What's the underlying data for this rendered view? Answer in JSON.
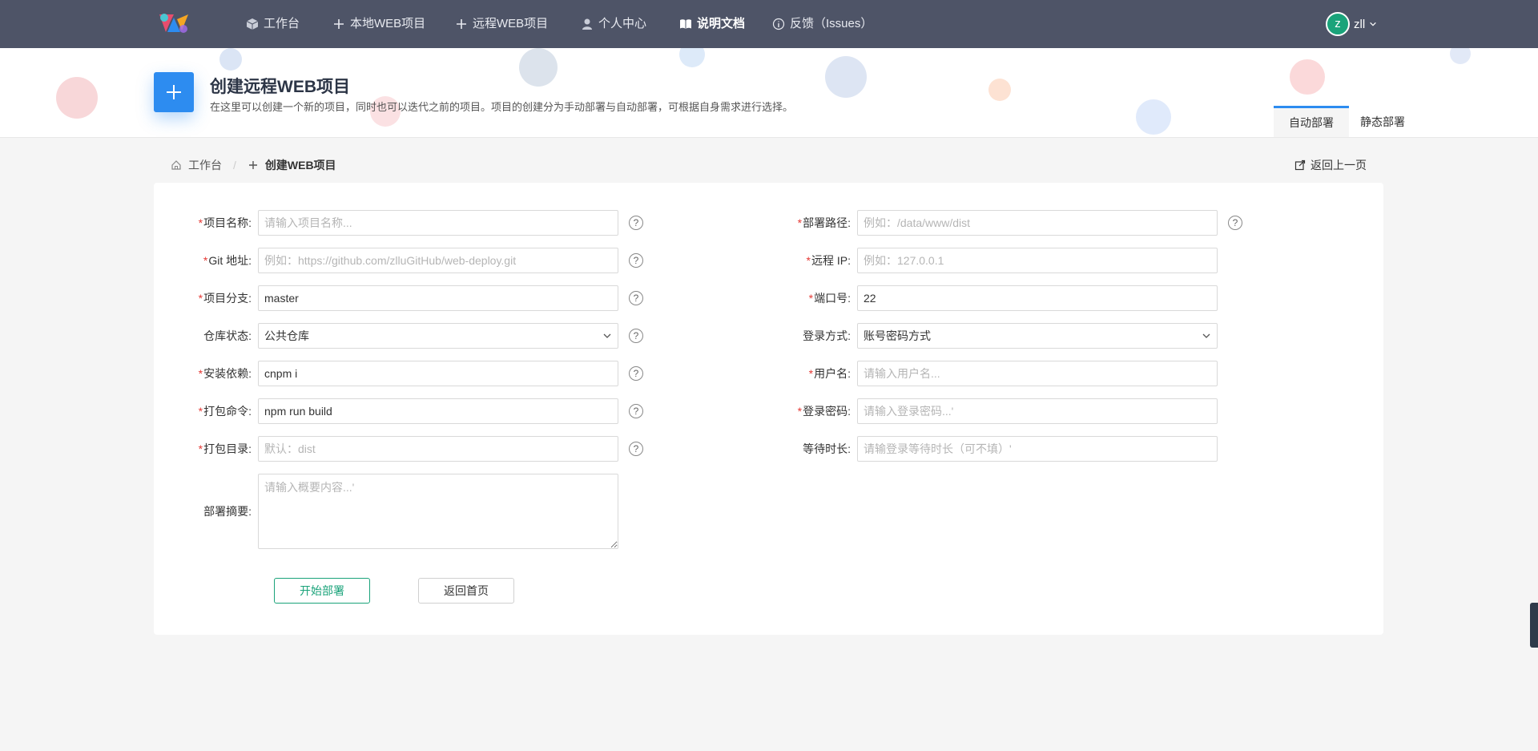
{
  "nav": {
    "items": [
      {
        "label": "工作台",
        "icon": "cube-icon"
      },
      {
        "label": "本地WEB项目",
        "icon": "plus-icon"
      },
      {
        "label": "远程WEB项目",
        "icon": "plus-icon"
      },
      {
        "label": "个人中心",
        "icon": "user-icon"
      },
      {
        "label": "说明文档",
        "icon": "book-icon"
      },
      {
        "label": "反馈（Issues）",
        "icon": "info-icon"
      }
    ],
    "user": {
      "avatar_letter": "z",
      "name": "zll"
    }
  },
  "banner": {
    "title": "创建远程WEB项目",
    "description": "在这里可以创建一个新的项目，同时也可以迭代之前的项目。项目的创建分为手动部署与自动部署，可根据自身需求进行选择。",
    "tabs": [
      "自动部署",
      "静态部署"
    ]
  },
  "breadcrumb": {
    "home": "工作台",
    "current": "创建WEB项目",
    "back": "返回上一页"
  },
  "form": {
    "left": [
      {
        "label": "项目名称:",
        "required": true,
        "value": "",
        "placeholder": "请输入项目名称..."
      },
      {
        "label": "Git 地址:",
        "required": true,
        "value": "",
        "placeholder": "例如：https://github.com/zlluGitHub/web-deploy.git"
      },
      {
        "label": "项目分支:",
        "required": true,
        "value": "master",
        "placeholder": ""
      },
      {
        "label": "仓库状态:",
        "required": false,
        "value": "公共仓库",
        "placeholder": ""
      },
      {
        "label": "安装依赖:",
        "required": true,
        "value": "cnpm i",
        "placeholder": ""
      },
      {
        "label": "打包命令:",
        "required": true,
        "value": "npm run build",
        "placeholder": ""
      },
      {
        "label": "打包目录:",
        "required": true,
        "value": "",
        "placeholder": "默认：dist"
      }
    ],
    "summary": {
      "label": "部署摘要:",
      "placeholder": "请输入概要内容...'"
    },
    "right": [
      {
        "label": "部署路径:",
        "required": true,
        "value": "",
        "placeholder": "例如：/data/www/dist"
      },
      {
        "label": "远程 IP:",
        "required": true,
        "value": "",
        "placeholder": "例如：127.0.0.1"
      },
      {
        "label": "端口号:",
        "required": true,
        "value": "22",
        "placeholder": ""
      },
      {
        "label": "登录方式:",
        "required": false,
        "value": "账号密码方式",
        "placeholder": ""
      },
      {
        "label": "用户名:",
        "required": true,
        "value": "",
        "placeholder": "请输入用户名..."
      },
      {
        "label": "登录密码:",
        "required": true,
        "value": "",
        "placeholder": "请输入登录密码...'"
      },
      {
        "label": "等待时长:",
        "required": false,
        "value": "",
        "placeholder": "请输登录等待时长（可不填）'"
      }
    ],
    "help_glyph": "?",
    "required_mark": "*",
    "buttons": {
      "start": "开始部署",
      "home": "返回首页"
    }
  },
  "colors": {
    "nav_bg": "#4e5467",
    "accent_blue": "#2d8cf0",
    "accent_green": "#1aa37a",
    "required": "#e53935"
  }
}
